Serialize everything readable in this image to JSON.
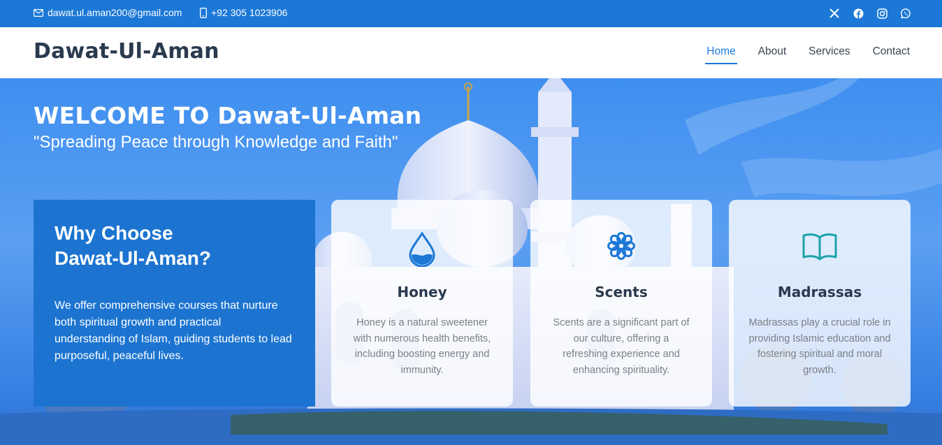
{
  "topbar": {
    "email": "dawat.ul.aman200@gmail.com",
    "phone": "+92 305 1023906",
    "social": [
      "x-icon",
      "facebook-icon",
      "instagram-icon",
      "whatsapp-icon"
    ]
  },
  "header": {
    "logo": "Dawat-Ul-Aman",
    "nav": [
      {
        "label": "Home",
        "active": true
      },
      {
        "label": "About",
        "active": false
      },
      {
        "label": "Services",
        "active": false
      },
      {
        "label": "Contact",
        "active": false
      }
    ]
  },
  "hero": {
    "title": "WELCOME TO Dawat-Ul-Aman",
    "subtitle": "\"Spreading Peace through Knowledge and Faith\""
  },
  "why": {
    "title_line1": "Why Choose",
    "title_line2": "Dawat-Ul-Aman?",
    "text": "We offer comprehensive courses that nurture both spiritual growth and practical understanding of Islam, guiding students to lead purposeful, peaceful lives."
  },
  "cards": [
    {
      "icon": "water-drop-icon",
      "title": "Honey",
      "text": "Honey is a natural sweetener with numerous health benefits, including boosting energy and immunity."
    },
    {
      "icon": "flower-icon",
      "title": "Scents",
      "text": "Scents are a significant part of our culture, offering a refreshing experience and enhancing spirituality."
    },
    {
      "icon": "book-icon",
      "title": "Madrassas",
      "text": "Madrassas play a crucial role in providing Islamic education and fostering spiritual and moral growth."
    }
  ],
  "colors": {
    "primary": "#1b78d6",
    "heading": "#2a3a4e",
    "icon_blue": "#1b78d6",
    "icon_teal": "#1aa3a8"
  }
}
